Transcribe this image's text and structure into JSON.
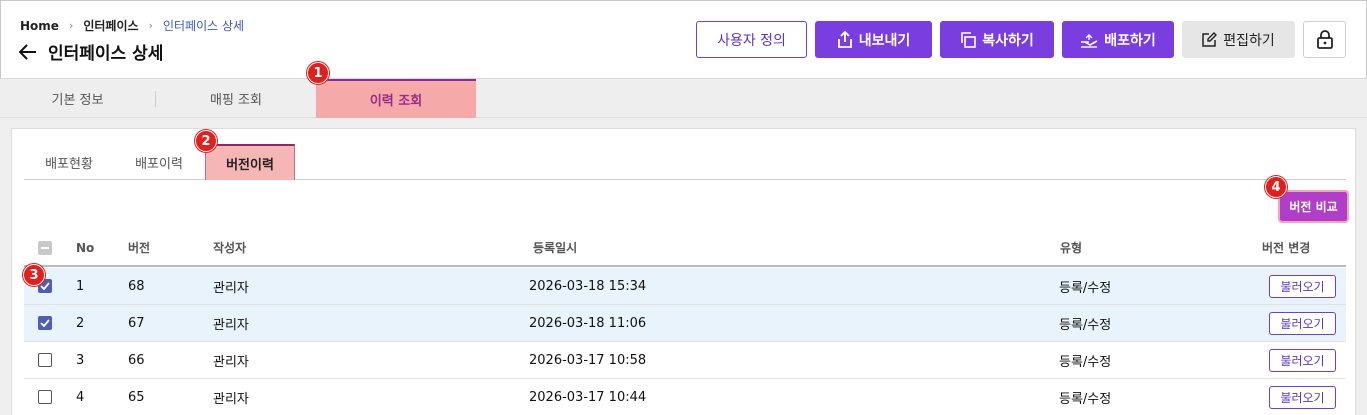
{
  "breadcrumb": {
    "items": [
      "Home",
      "인터페이스",
      "인터페이스 상세"
    ]
  },
  "page": {
    "title": "인터페이스 상세"
  },
  "actions": {
    "define_user": "사용자 정의",
    "export": "내보내기",
    "copy": "복사하기",
    "deploy": "배포하기",
    "edit": "편집하기"
  },
  "main_tabs": [
    "기본 정보",
    "매핑 조회",
    "이력 조회"
  ],
  "sub_tabs": [
    "배포현황",
    "배포이력",
    "버전이력"
  ],
  "compare_button": "버전 비교",
  "table": {
    "headers": {
      "no": "No",
      "version": "버전",
      "author": "작성자",
      "date": "등록일시",
      "type": "유형",
      "change": "버전 변경"
    },
    "rows": [
      {
        "no": "1",
        "version": "68",
        "author": "관리자",
        "date": "2026-03-18 15:34",
        "type": "등록/수정",
        "action": "불러오기",
        "checked": true
      },
      {
        "no": "2",
        "version": "67",
        "author": "관리자",
        "date": "2026-03-18 11:06",
        "type": "등록/수정",
        "action": "불러오기",
        "checked": true
      },
      {
        "no": "3",
        "version": "66",
        "author": "관리자",
        "date": "2026-03-17 10:58",
        "type": "등록/수정",
        "action": "불러오기",
        "checked": false
      },
      {
        "no": "4",
        "version": "65",
        "author": "관리자",
        "date": "2026-03-17 10:44",
        "type": "등록/수정",
        "action": "불러오기",
        "checked": false
      }
    ]
  },
  "markers": [
    "1",
    "2",
    "3",
    "4"
  ],
  "colors": {
    "primary": "#7a3ee0",
    "highlight": "#f6a9a9",
    "marker": "#e0201e",
    "selected_row": "#e8f3fb"
  }
}
